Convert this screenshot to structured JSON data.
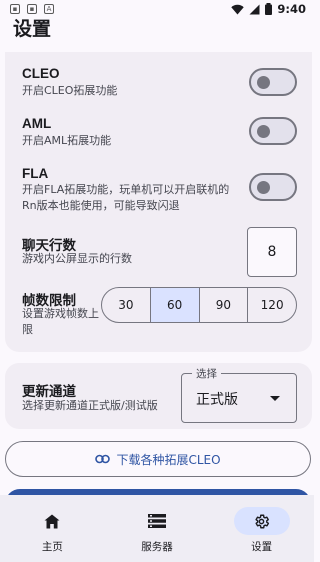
{
  "status_bar": {
    "time": "9:40"
  },
  "page": {
    "title": "设置"
  },
  "settings": {
    "cleo": {
      "title": "CLEO",
      "desc": "开启CLEO拓展功能",
      "enabled": false
    },
    "aml": {
      "title": "AML",
      "desc": "开启AML拓展功能",
      "enabled": false
    },
    "fla": {
      "title": "FLA",
      "desc": "开启FLA拓展功能，玩单机可以开启联机的Rn版本也能使用，可能导致闪退",
      "enabled": false
    },
    "chat_lines": {
      "title": "聊天行数",
      "desc": "游戏内公屏显示的行数",
      "value": "8"
    },
    "fps_limit": {
      "title": "帧数限制",
      "desc": "设置游戏帧数上限",
      "options": [
        "30",
        "60",
        "90",
        "120"
      ],
      "selected": "60"
    },
    "update_channel": {
      "title": "更新通道",
      "desc": "选择更新通道正式版/测试版",
      "select_label": "选择",
      "selected": "正式版"
    }
  },
  "buttons": {
    "download_cleo": "下载各种拓展CLEO"
  },
  "bottom_nav": {
    "items": [
      {
        "label": "主页",
        "icon": "home-icon"
      },
      {
        "label": "服务器",
        "icon": "server-icon"
      },
      {
        "label": "设置",
        "icon": "settings-gear-icon",
        "active": true
      }
    ]
  },
  "colors": {
    "accent": "#2f55a4",
    "selected_segment": "#dae2ff",
    "nav_active": "#d9e2ff"
  }
}
